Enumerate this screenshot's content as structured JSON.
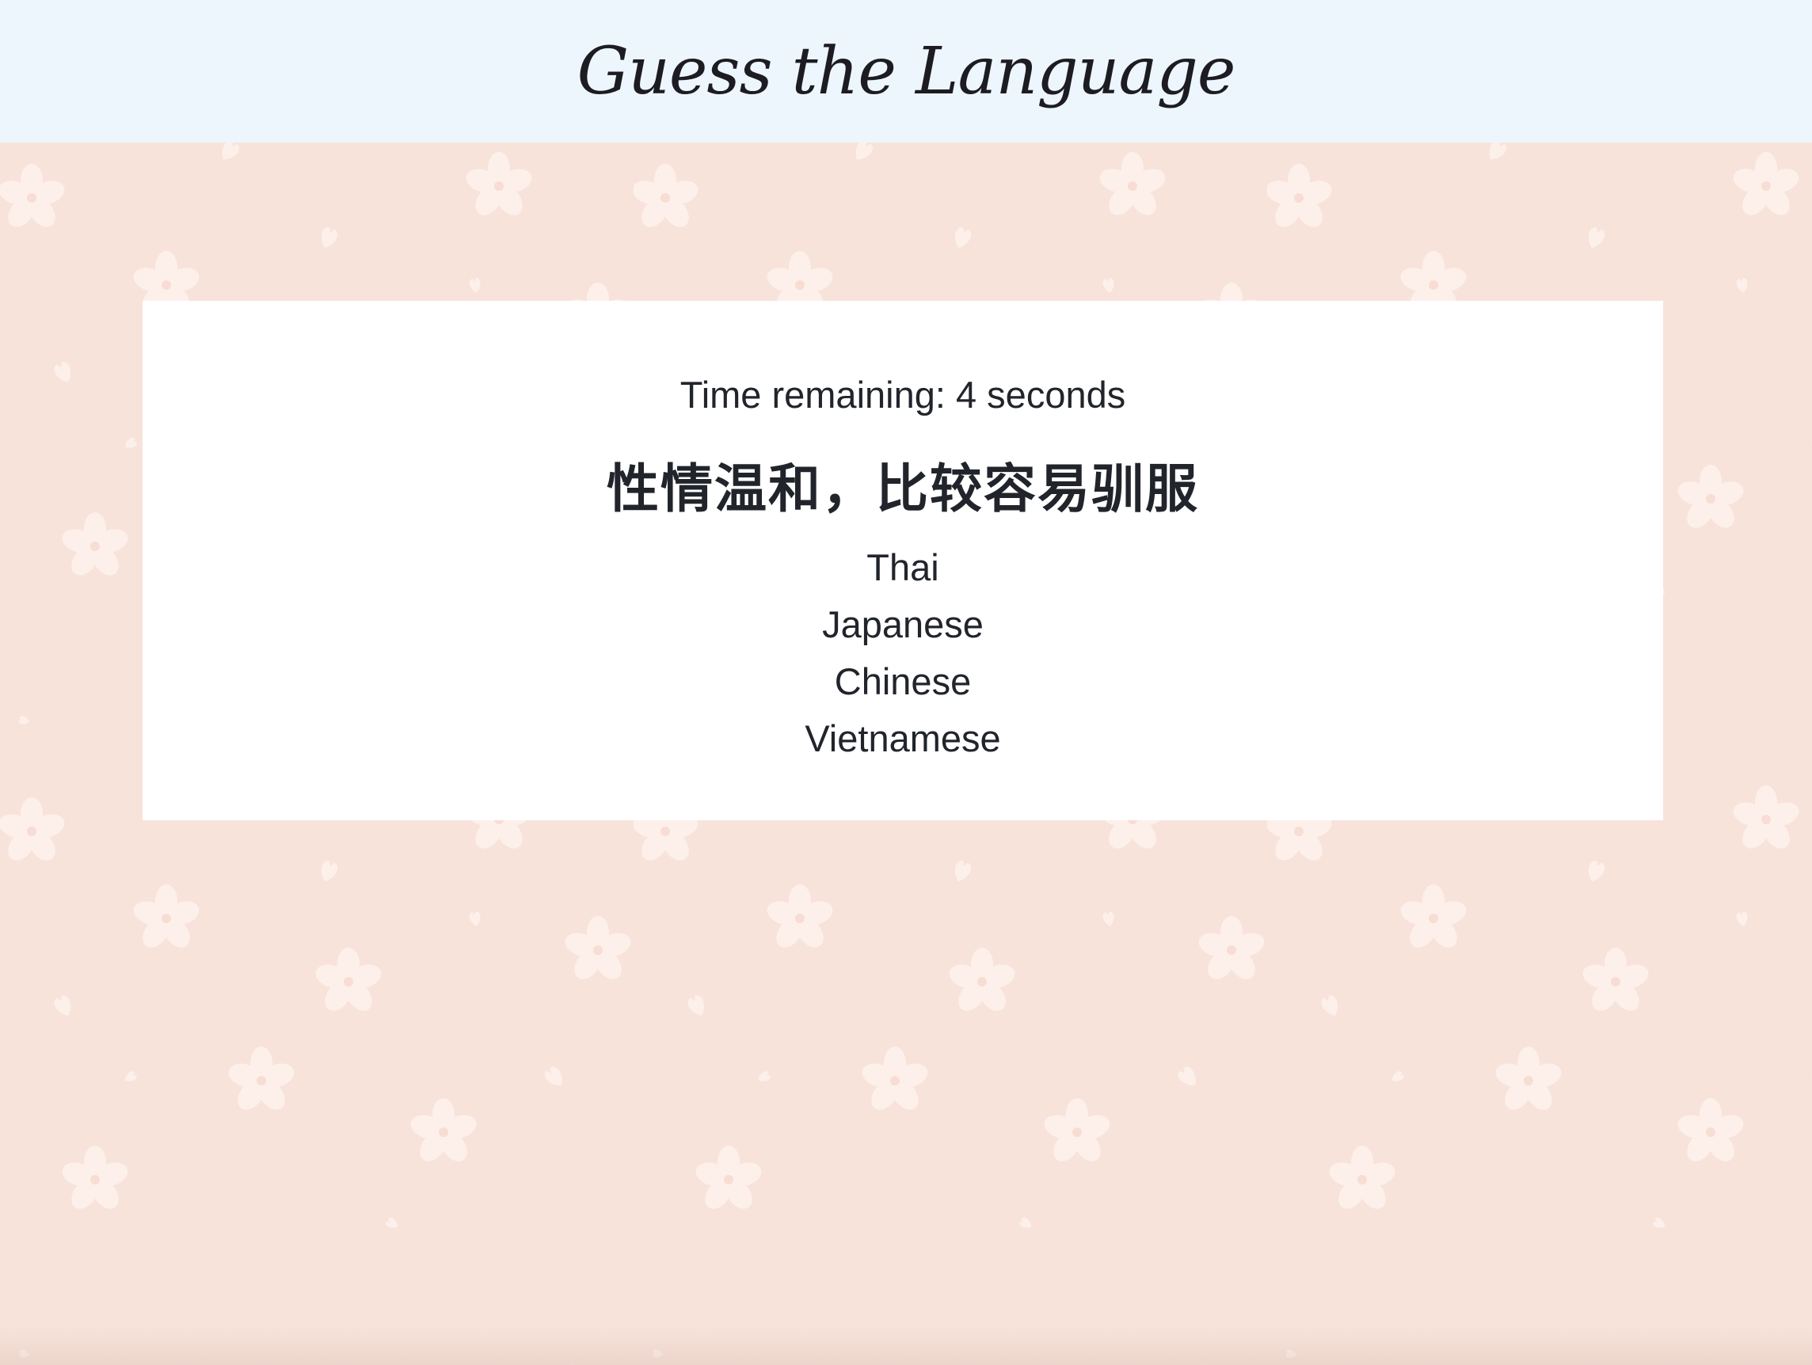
{
  "header": {
    "title": "Guess the Language"
  },
  "game": {
    "timer_text": "Time remaining: 4 seconds",
    "phrase": "性情温和，比较容易驯服",
    "options": [
      "Thai",
      "Japanese",
      "Chinese",
      "Vietnamese"
    ]
  },
  "colors": {
    "background": "#f8e3da",
    "header_background": "#eef6fd",
    "card_background": "#ffffff",
    "text": "#21252b",
    "pattern_flower": "#fdf0eb"
  },
  "icons": {
    "background_pattern": "sakura-flower-petal-pattern"
  }
}
